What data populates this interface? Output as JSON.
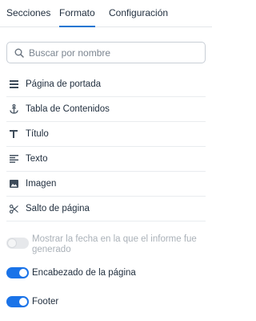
{
  "tabs": [
    {
      "label": "Secciones"
    },
    {
      "label": "Formato"
    },
    {
      "label": "Configuración"
    }
  ],
  "active_tab": "Formato",
  "search": {
    "placeholder": "Buscar por nombre",
    "value": ""
  },
  "items": [
    {
      "label": "Página de portada",
      "icon": "cover-page-icon"
    },
    {
      "label": "Tabla de Contenidos",
      "icon": "anchor-icon"
    },
    {
      "label": "Título",
      "icon": "title-icon"
    },
    {
      "label": "Texto",
      "icon": "text-icon"
    },
    {
      "label": "Imagen",
      "icon": "image-icon"
    },
    {
      "label": "Salto de página",
      "icon": "scissors-icon"
    }
  ],
  "options": [
    {
      "label": "Mostrar la fecha en la que el informe fue generado",
      "enabled": false,
      "disabled": true
    },
    {
      "label": "Encabezado de la página",
      "enabled": true,
      "disabled": false
    },
    {
      "label": "Footer",
      "enabled": true,
      "disabled": false
    }
  ],
  "colors": {
    "accent": "#1a73e8",
    "tab_underline": "#1976d2"
  }
}
